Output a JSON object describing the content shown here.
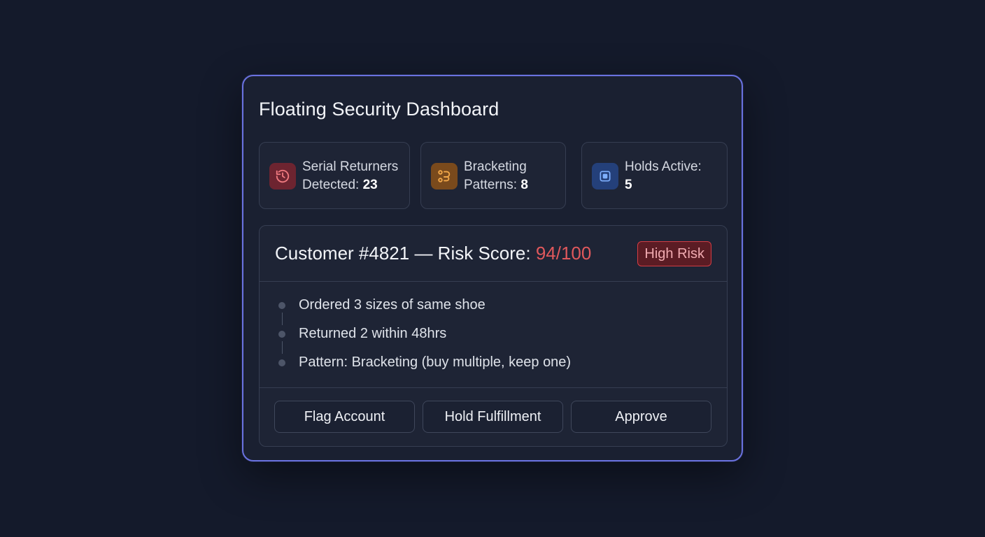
{
  "dashboard": {
    "title": "Floating Security Dashboard",
    "accent_color": "#6a72e0"
  },
  "stats": [
    {
      "icon": "history-icon",
      "color": "#e0585c",
      "label_line1": "Serial Returners",
      "label_line2": "Detected:",
      "value": "23"
    },
    {
      "icon": "branch-pattern-icon",
      "color": "#e0962c",
      "label_line1": "Bracketing",
      "label_line2": "Patterns:",
      "value": "8"
    },
    {
      "icon": "hold-box-icon",
      "color": "#4a84e8",
      "label_line1": "Holds Active:",
      "label_line2": "",
      "value": "5"
    }
  ],
  "customer": {
    "title_prefix": "Customer #4821 — Risk Score: ",
    "score": "94/100",
    "score_color": "#e0585c",
    "badge": "High Risk",
    "events": [
      "Ordered 3 sizes of same shoe",
      "Returned 2 within 48hrs",
      "Pattern: Bracketing (buy multiple, keep one)"
    ]
  },
  "actions": {
    "flag": "Flag Account",
    "hold": "Hold Fulfillment",
    "approve": "Approve"
  }
}
